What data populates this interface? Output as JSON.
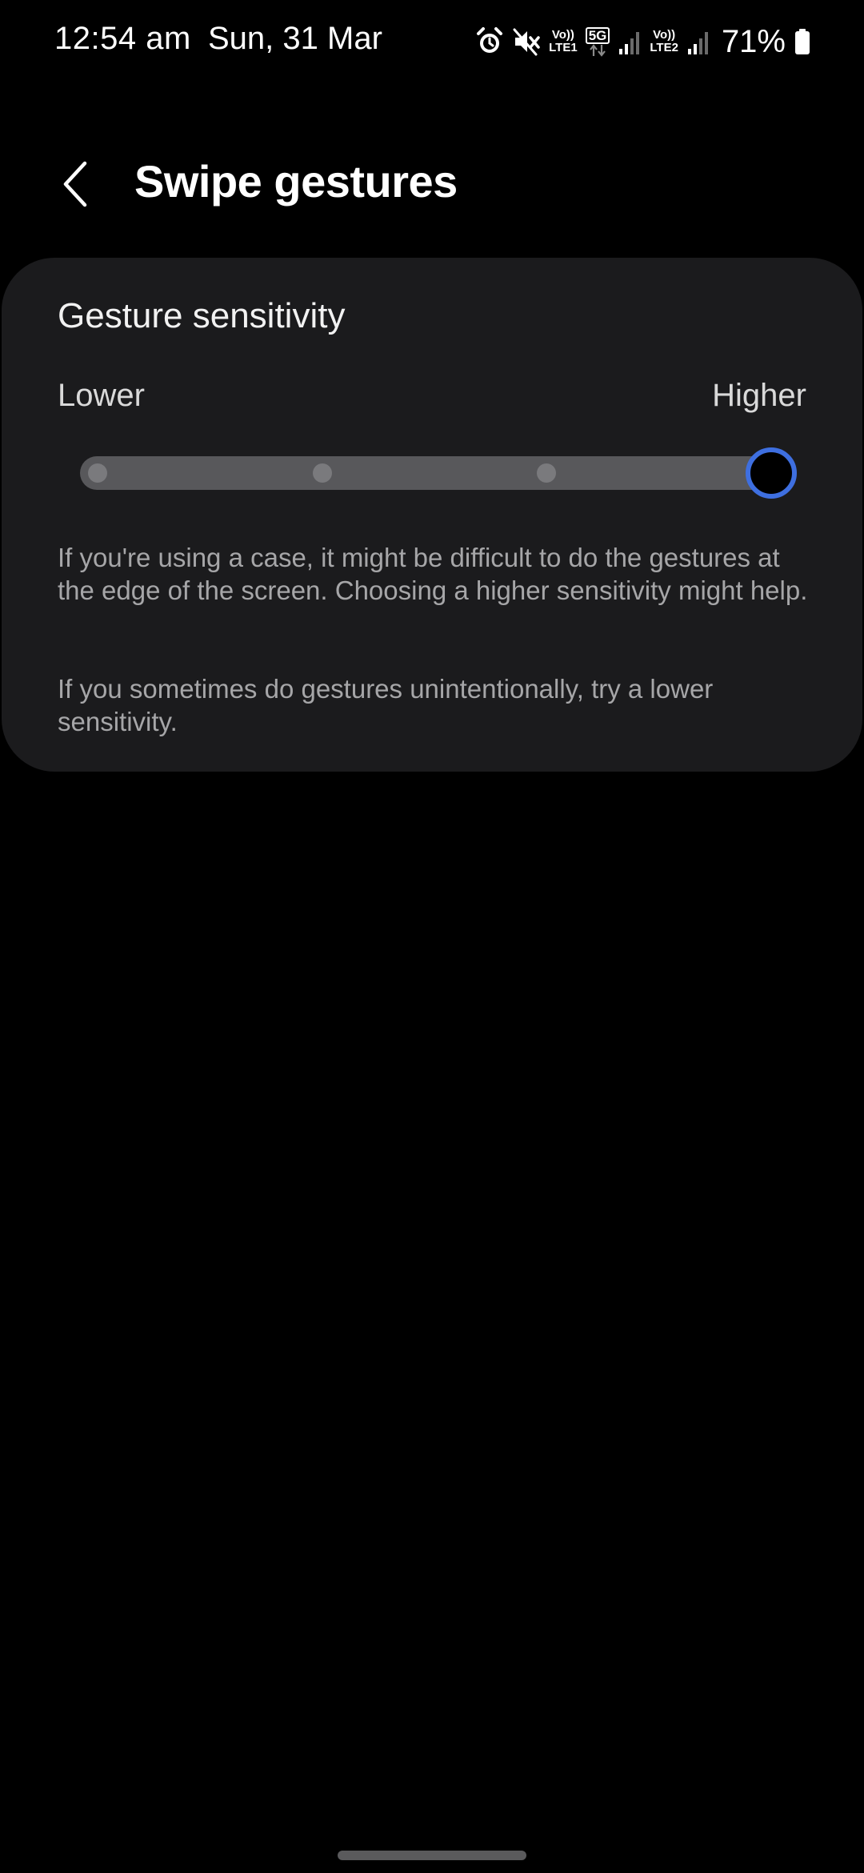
{
  "status_bar": {
    "time": "12:54 am",
    "date": "Sun, 31 Mar",
    "sim1_label_top": "Vo))",
    "sim1_label_bottom": "LTE1",
    "network_type": "5G",
    "sim2_label_top": "Vo))",
    "sim2_label_bottom": "LTE2",
    "battery_percent": "71%",
    "icons": [
      "alarm-icon",
      "mute-icon",
      "signal-icon",
      "signal-icon",
      "battery-icon"
    ]
  },
  "header": {
    "title": "Swipe gestures",
    "back_icon": "chevron-left-icon"
  },
  "gesture_sensitivity": {
    "title": "Gesture sensitivity",
    "min_label": "Lower",
    "max_label": "Higher",
    "steps": 4,
    "selected_step": 4,
    "accent_color": "#3e6fe0",
    "description_1": "If you're using a case, it might be difficult to do the gestures at the edge of the screen. Choosing a higher sensitivity might help.",
    "description_2": "If you sometimes do gestures unintentionally, try a lower sensitivity."
  }
}
